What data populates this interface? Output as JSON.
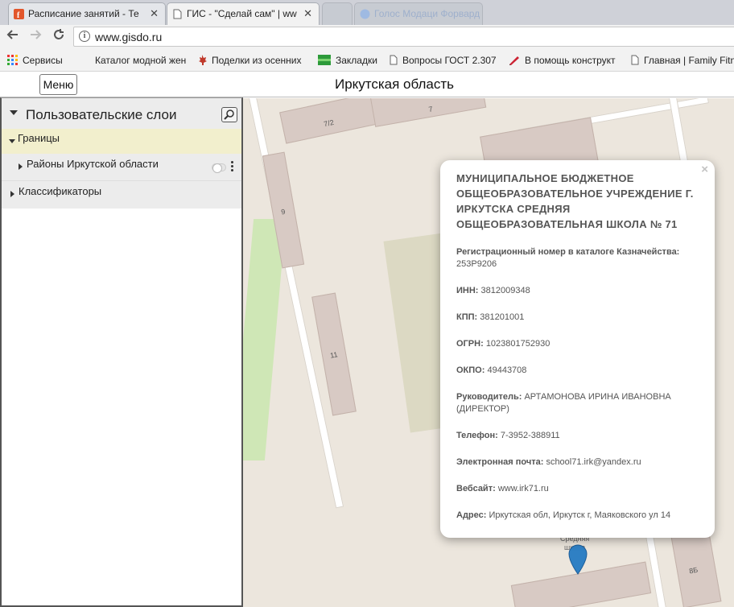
{
  "browser": {
    "tabs": [
      {
        "title": "Расписание занятий - Те",
        "close": "✕",
        "favicon_color": "#e2562b"
      },
      {
        "title": "ГИС - \"Сделай сам\" | ww",
        "close": "✕",
        "favicon_color": "#888888"
      },
      {
        "title": "",
        "close": ""
      },
      {
        "title": "Голос Модаци Форвард",
        "close": ""
      }
    ],
    "url": "www.gisdo.ru"
  },
  "bookmarks": [
    {
      "label": "Сервисы",
      "icon": "apps-grid-icon"
    },
    {
      "label": "Каталог модной жен",
      "icon": "none"
    },
    {
      "label": "Поделки из осенних",
      "icon": "maple-leaf-icon"
    },
    {
      "label": "Закладки",
      "icon": "green-bar-icon"
    },
    {
      "label": "Вопросы ГОСТ 2.307",
      "icon": "page-icon"
    },
    {
      "label": "В помощь конструкт",
      "icon": "pencil-icon"
    },
    {
      "label": "Главная | Family Fitn",
      "icon": "page-icon"
    }
  ],
  "app": {
    "menu_label": "Меню",
    "region_title": "Иркутская область"
  },
  "sidebar": {
    "title": "Пользовательские слои",
    "groups": [
      {
        "label": "Границы",
        "expanded": true
      },
      {
        "label": "Районы Иркутской области",
        "toggle": false
      },
      {
        "label": "Классификаторы",
        "expanded": false
      }
    ]
  },
  "map": {
    "building_labels": [
      "7",
      "7/2",
      "9",
      "11",
      "8Б",
      "Средняя",
      "школа"
    ],
    "colors": {
      "background": "#ece6dd",
      "building": "#d8cac4",
      "park": "#cfe7b6",
      "marker": "#2f80c4"
    }
  },
  "popup": {
    "close": "×",
    "org_name": "МУНИЦИПАЛЬНОЕ БЮДЖЕТНОЕ ОБЩЕОБРАЗОВАТЕЛЬНОЕ УЧРЕЖДЕНИЕ Г. ИРКУТСКА СРЕДНЯЯ ОБЩЕОБРАЗОВАТЕЛЬНАЯ ШКОЛА № 71",
    "fields": [
      {
        "label": "Регистрационный номер в каталоге Казначейства:",
        "value": "253P9206"
      },
      {
        "label": "ИНН:",
        "value": "3812009348"
      },
      {
        "label": "КПП:",
        "value": "381201001"
      },
      {
        "label": "ОГРН:",
        "value": "1023801752930"
      },
      {
        "label": "ОКПО:",
        "value": "49443708"
      },
      {
        "label": "Руководитель:",
        "value": "АРТАМОНОВА ИРИНА ИВАНОВНА (ДИРЕКТОР)"
      },
      {
        "label": "Телефон:",
        "value": "7-3952-388911"
      },
      {
        "label": "Электронная почта:",
        "value": "school71.irk@yandex.ru"
      },
      {
        "label": "Вебсайт:",
        "value": "www.irk71.ru"
      },
      {
        "label": "Адрес:",
        "value": "Иркутская обл, Иркутск г, Маяковского ул 14"
      }
    ]
  }
}
